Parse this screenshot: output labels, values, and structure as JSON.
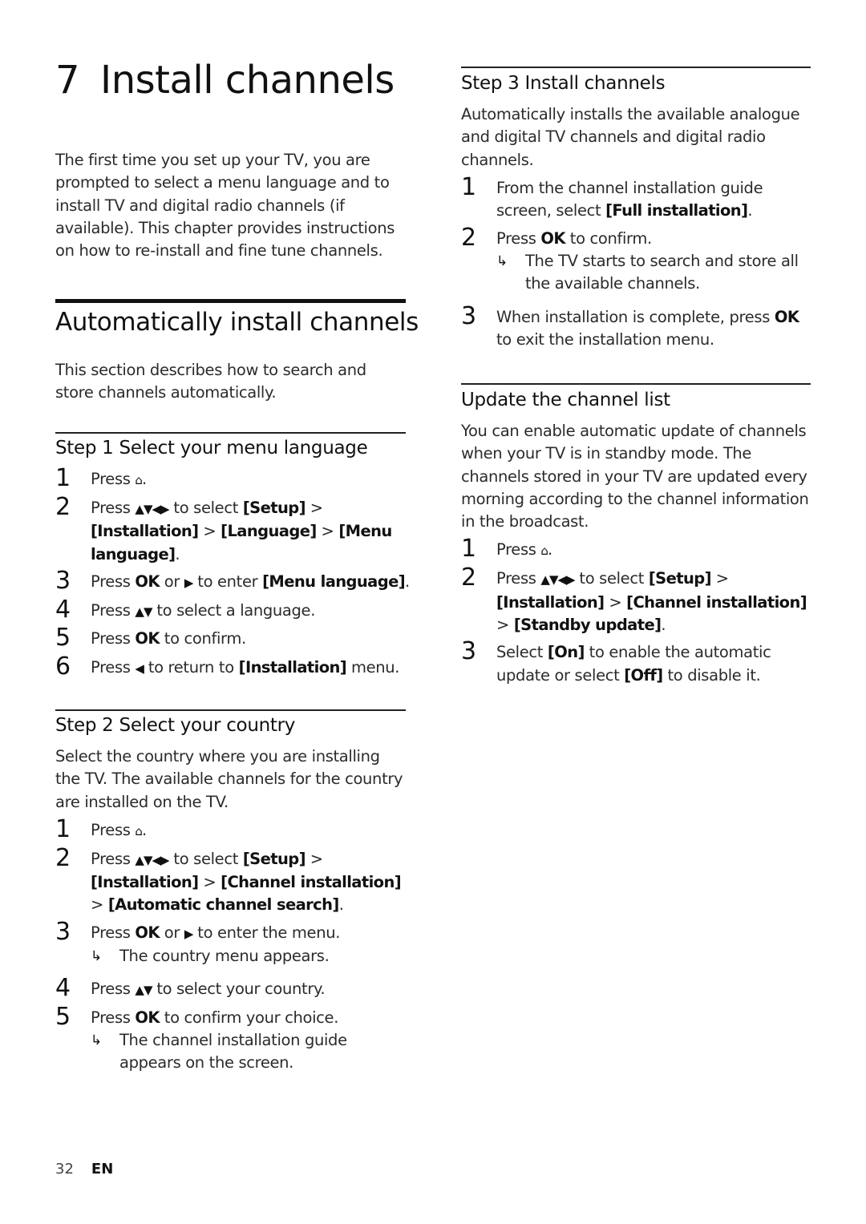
{
  "chapter": {
    "number": "7",
    "title": "Install channels",
    "intro": "The first time you set up your TV, you are prompted to select a menu language and to install TV and digital radio channels (if available). This chapter provides instructions on how to re-install and fine tune channels."
  },
  "auto_section": {
    "title": "Automatically install channels",
    "intro": "This section describes how to search and store channels automatically."
  },
  "step1": {
    "title": "Step 1 Select your menu language",
    "items": [
      {
        "n": "1",
        "pre": "Press ",
        "icon": "home-icon",
        "glyph": "⌂",
        "post": "."
      },
      {
        "n": "2",
        "pre": "Press ",
        "glyph": "▲▼◀▶",
        "mid": " to select ",
        "path": [
          "[Setup]",
          "[Installation]",
          "[Language]",
          "[Menu language]"
        ],
        "sep": " > ",
        "post": "."
      },
      {
        "n": "3",
        "pre": "Press ",
        "key": "OK",
        "mid": " or ",
        "glyph": "▶",
        "mid2": " to enter ",
        "target": "[Menu language]",
        "post": "."
      },
      {
        "n": "4",
        "pre": "Press ",
        "glyph": "▲▼",
        "post": " to select a language."
      },
      {
        "n": "5",
        "pre": "Press ",
        "key": "OK",
        "post": " to confirm."
      },
      {
        "n": "6",
        "pre": "Press ",
        "glyph": "◀",
        "mid": " to return to ",
        "target": "[Installation]",
        "post": " menu."
      }
    ]
  },
  "step2": {
    "title": "Step 2 Select your country",
    "intro": "Select the country where you are installing the TV. The available channels for the country are installed on the TV.",
    "items": [
      {
        "n": "1",
        "pre": "Press ",
        "glyph": "⌂",
        "post": "."
      },
      {
        "n": "2",
        "pre": "Press ",
        "glyph": "▲▼◀▶",
        "mid": " to select ",
        "path": [
          "[Setup]",
          "[Installation]",
          "[Channel installation]",
          "[Automatic channel search]"
        ],
        "sep": " > ",
        "post": "."
      },
      {
        "n": "3",
        "pre": "Press ",
        "key": "OK",
        "mid": " or ",
        "glyph": "▶",
        "post": " to enter the menu.",
        "result": "The country menu appears."
      },
      {
        "n": "4",
        "pre": "Press ",
        "glyph": "▲▼",
        "post": " to select your country."
      },
      {
        "n": "5",
        "pre": "Press ",
        "key": "OK",
        "post": " to confirm your choice.",
        "result": "The channel installation guide appears on the screen."
      }
    ]
  },
  "step3": {
    "title": "Step 3 Install channels",
    "intro": "Automatically installs the available analogue and digital TV channels and digital radio channels.",
    "items": [
      {
        "n": "1",
        "pre": "From the channel installation guide screen, select ",
        "target": "[Full installation]",
        "post": "."
      },
      {
        "n": "2",
        "pre": "Press ",
        "key": "OK",
        "post": " to confirm.",
        "result": "The TV starts to search and store all the available channels."
      },
      {
        "n": "3",
        "pre": "When installation is complete, press ",
        "key": "OK",
        "post": " to exit the installation menu."
      }
    ]
  },
  "update": {
    "title": "Update the channel list",
    "intro": "You can enable automatic update of channels when your TV is in standby mode. The channels stored in your TV are updated every morning according to the channel information in the broadcast.",
    "items": [
      {
        "n": "1",
        "pre": "Press ",
        "glyph": "⌂",
        "post": "."
      },
      {
        "n": "2",
        "pre": "Press ",
        "glyph": "▲▼◀▶",
        "mid": " to select ",
        "path": [
          "[Setup]",
          "[Installation]",
          "[Channel installation]",
          "[Standby update]"
        ],
        "sep": " > ",
        "post": "."
      },
      {
        "n": "3",
        "pre": "Select ",
        "target": "[On]",
        "mid": " to enable the automatic update or select ",
        "target2": "[Off]",
        "post": " to disable it."
      }
    ]
  },
  "footer": {
    "page": "32",
    "lang": "EN"
  },
  "symbols": {
    "result_arrow": "↳"
  }
}
